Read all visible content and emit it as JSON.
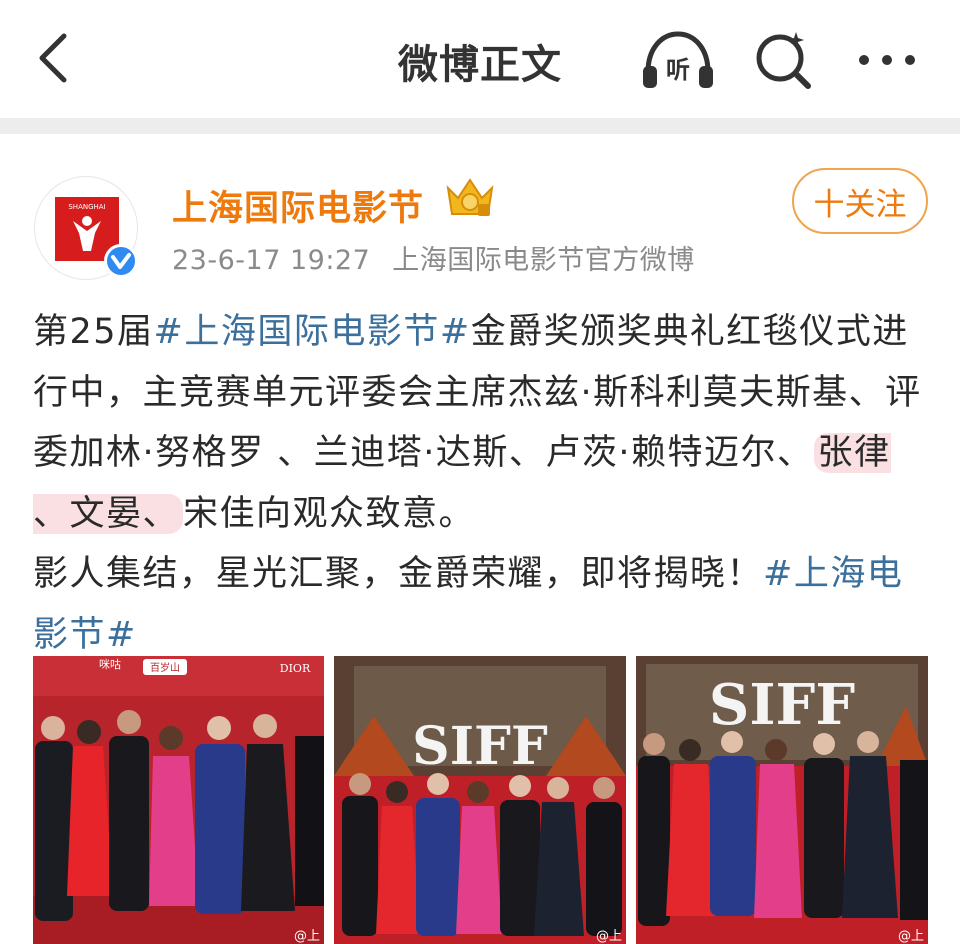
{
  "header": {
    "title": "微博正文",
    "back_icon": "chevron-left-icon",
    "listen_label": "听",
    "search_icon": "search-icon",
    "more_icon": "more-dots-icon"
  },
  "author": {
    "name": "上海国际电影节",
    "avatar_text": "SHANGHAI",
    "badge_icon": "crown-vip-icon",
    "verified_icon": "verified-check-icon",
    "date": "23-6-17 19:27",
    "source": "上海国际电影节官方微博",
    "follow_label": "十关注"
  },
  "post": {
    "segments": {
      "s1": "第25届",
      "tag1": "#上海国际电影节#",
      "s2": "金爵奖颁奖典礼红毯仪式进行中，主竞赛单元评委会主席杰兹·斯科利莫夫斯基、评委加林·努格罗 、兰迪塔·达斯、卢茨·赖特迈尔、",
      "hl": "张律 、文晏、",
      "s3": "宋佳向观众致意。",
      "s4": "影人集结，星光汇聚，金爵荣耀，即将揭晓！",
      "tag2": "#上海电影节#"
    }
  },
  "images": {
    "watermark": "@上",
    "siff": "SIFF",
    "sponsor_top": "百岁山",
    "sponsor_brand": "DIOR",
    "sponsor_migu": "咪咕"
  },
  "colors": {
    "orange": "#ee7a0d",
    "link": "#3b6f9c",
    "carpet": "#c0272d",
    "highlight": "#fbe0e3"
  }
}
